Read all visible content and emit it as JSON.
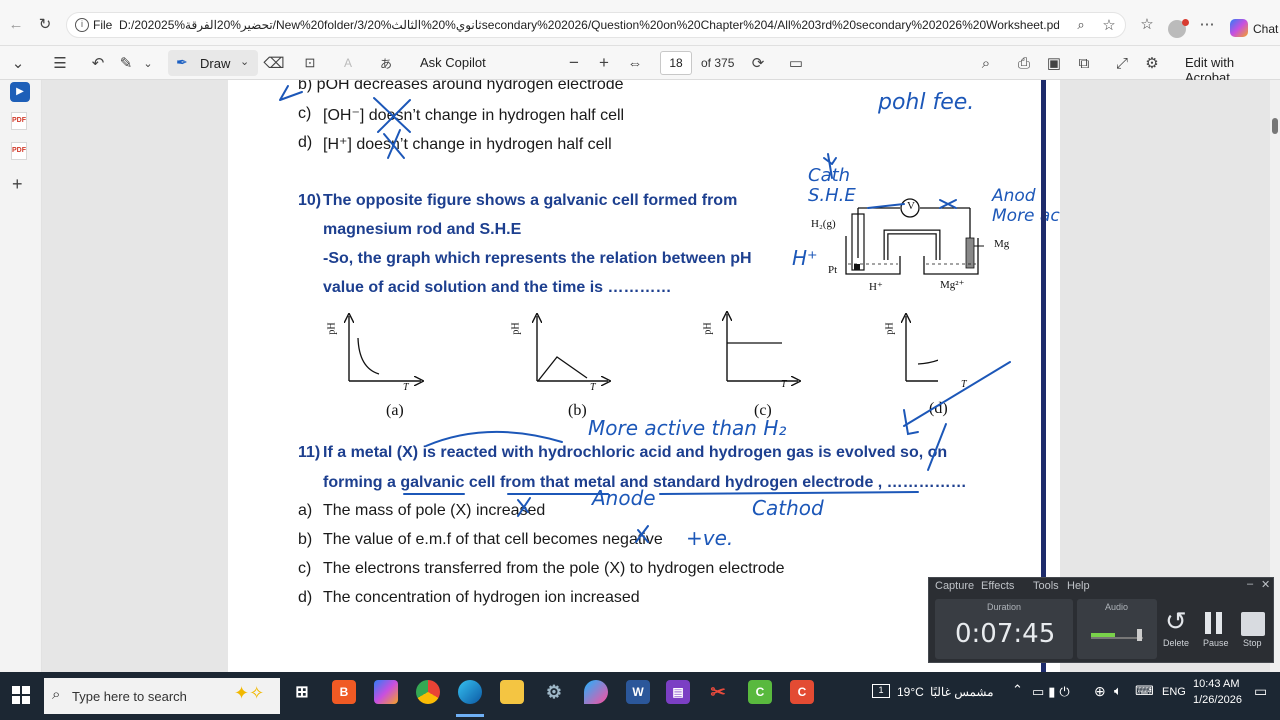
{
  "browser": {
    "file_label": "File",
    "url": "D:/202025%تحضير%20الفرقة/New%20folder/3/ثانوي%20%الثالث%20secondary%202026/Question%20on%20Chapter%204/All%203rd%20secondary%202026%20Worksheet.pdf",
    "chat_label": "Chat"
  },
  "pdf_toolbar": {
    "draw_label": "Draw",
    "ask_copilot": "Ask Copilot",
    "current_page": "18",
    "total_pages": "of 375",
    "edit_acrobat": "Edit with Acrobat"
  },
  "document": {
    "q9": {
      "b": "b)  pOH decreases around hydrogen electrode",
      "c_letter": "c)",
      "c_text": "[OH⁻] doesn’t change in hydrogen half cell",
      "d_letter": "d)",
      "d_text": "[H⁺] doesn’t change in hydrogen half cell"
    },
    "q10": {
      "number": "10)",
      "line1": "The opposite figure shows a galvanic cell formed from",
      "line2": "magnesium rod and S.H.E",
      "line3": "-So, the graph which represents the relation between pH",
      "line4": "value of acid solution and the time is …………",
      "figure": {
        "h2": "H₂(g)",
        "v": "V",
        "mg": "Mg",
        "pt": "Pt",
        "h_ion": "H⁺",
        "mg_ion": "Mg²⁺"
      },
      "graphs": [
        {
          "label": "(a)",
          "y": "pH",
          "x": "T"
        },
        {
          "label": "(b)",
          "y": "pH",
          "x": "T"
        },
        {
          "label": "(c)",
          "y": "pH",
          "x": "T"
        },
        {
          "label": "(d)",
          "y": "pH",
          "x": "T"
        }
      ]
    },
    "q11": {
      "number": "11)",
      "line1": "If a metal (X) is reacted with hydrochloric acid and hydrogen gas is evolved so, on",
      "line2": "forming a galvanic cell from that metal and standard hydrogen electrode , ……………",
      "options": [
        {
          "letter": "a)",
          "text": "The mass of pole (X) increased"
        },
        {
          "letter": "b)",
          "text": "The value of e.m.f of that cell becomes negative"
        },
        {
          "letter": "c)",
          "text": "The electrons transferred from the pole (X) to hydrogen electrode"
        },
        {
          "letter": "d)",
          "text": "The concentration of hydrogen ion increased"
        }
      ]
    },
    "handwriting": {
      "top_right": "pohl fee.",
      "cathode_she": "Cath S.H.E",
      "anode_more": "Anod More acti",
      "h_plus": "H⁺",
      "more_active": "More active than H₂",
      "anode": "Anode",
      "cathode": "Cathod",
      "plus_ve": "+ve."
    }
  },
  "recorder": {
    "menu": [
      "Capture",
      "Effects",
      "Tools",
      "Help"
    ],
    "duration_label": "Duration",
    "duration": "0:07:45",
    "audio_label": "Audio",
    "delete": "Delete",
    "pause": "Pause",
    "stop": "Stop"
  },
  "taskbar": {
    "search_placeholder": "Type here to search",
    "weather": "19°C",
    "weather_text": "مشمس غالبًا",
    "lang": "ENG",
    "time": "10:43 AM",
    "date": "1/26/2026"
  }
}
